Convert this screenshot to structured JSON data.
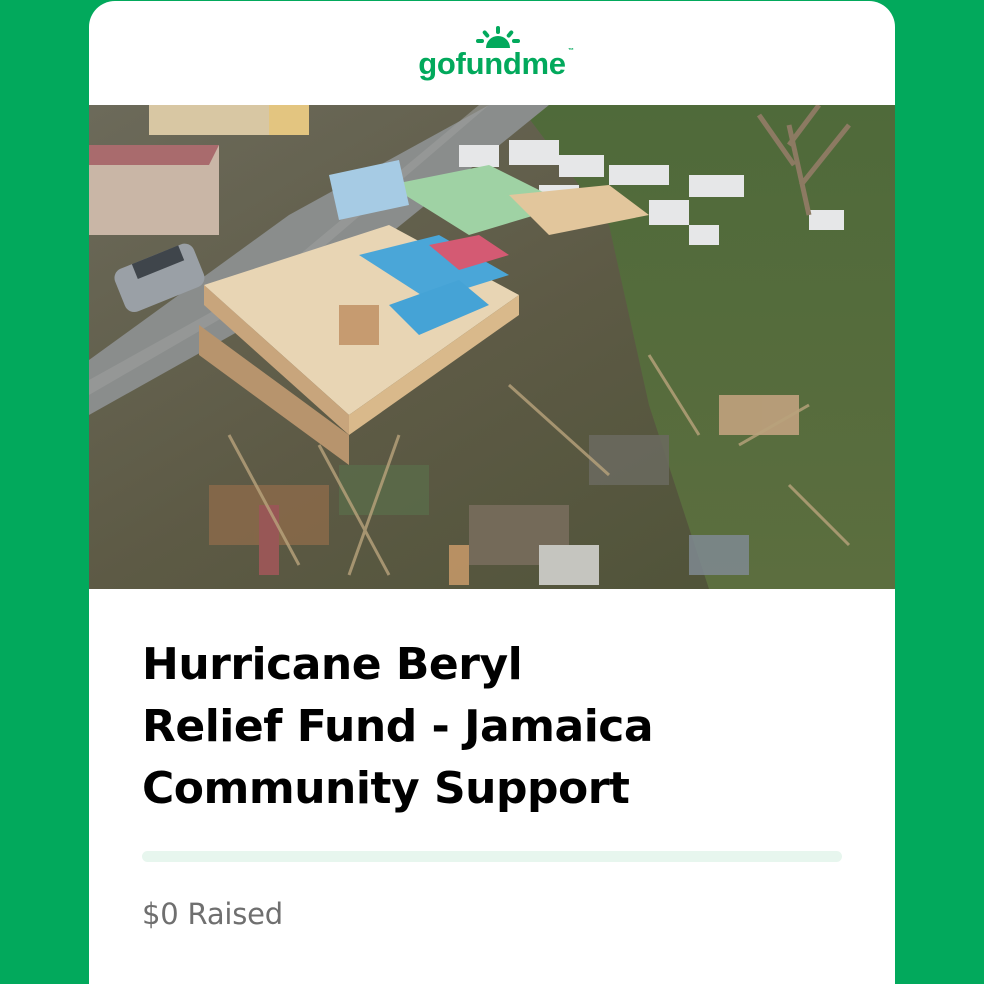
{
  "brand": {
    "name": "gofundme",
    "trademark": "™",
    "color": "#02a95c",
    "logo_icon": "sunrise-icon"
  },
  "campaign": {
    "image_alt_subject": "aerial-photo-hurricane-damage",
    "title_lines": [
      "Hurricane Beryl",
      "Relief Fund - Jamaica",
      "Community Support"
    ],
    "progress_fraction": 0,
    "raised_text": "$0 Raised"
  },
  "colors": {
    "background": "#02a95c",
    "card": "#ffffff",
    "progress_track": "#e7f6ee",
    "raised_text": "#6f6f6f"
  }
}
